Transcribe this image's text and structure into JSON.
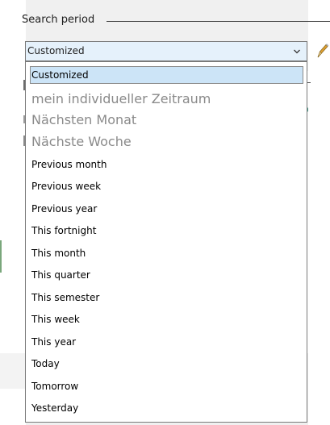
{
  "group": {
    "title": "Search period"
  },
  "combo": {
    "value": "Customized"
  },
  "icons": {
    "dropdown_arrow": "chevron-down-icon",
    "edit": "pencil-icon"
  },
  "dropdown": {
    "selected_index": 0,
    "options": [
      "Customized",
      "mein individueller Zeitraum",
      "Nächsten Monat",
      "Nächste Woche",
      "Previous month",
      "Previous week",
      "Previous year",
      "This fortnight",
      "This month",
      "This quarter",
      "This semester",
      "This week",
      "This year",
      "Today",
      "Tomorrow",
      "Yesterday"
    ]
  },
  "colors": {
    "combo_background": "#e5f1fb",
    "selected_background": "#cce4f7",
    "muted_text": "#8a8a8a",
    "pencil_accent": "#e0a030"
  }
}
